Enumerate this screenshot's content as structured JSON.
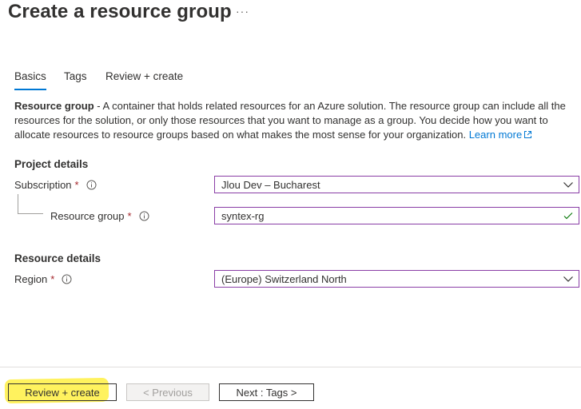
{
  "header": {
    "title": "Create a resource group",
    "more_label": "···"
  },
  "tabs": [
    {
      "label": "Basics",
      "active": true
    },
    {
      "label": "Tags",
      "active": false
    },
    {
      "label": "Review + create",
      "active": false
    }
  ],
  "description": {
    "bold": "Resource group",
    "text": " - A container that holds related resources for an Azure solution. The resource group can include all the resources for the solution, or only those resources that you want to manage as a group. You decide how you want to allocate resources to resource groups based on what makes the most sense for your organization. ",
    "link": "Learn more"
  },
  "project_details": {
    "heading": "Project details",
    "subscription": {
      "label": "Subscription",
      "required": "*",
      "value": "Jlou Dev – Bucharest"
    },
    "resource_group": {
      "label": "Resource group",
      "required": "*",
      "value": "syntex-rg"
    }
  },
  "resource_details": {
    "heading": "Resource details",
    "region": {
      "label": "Region",
      "required": "*",
      "value": "(Europe) Switzerland North"
    }
  },
  "footer": {
    "review_create": "Review + create",
    "previous": "< Previous",
    "next": "Next : Tags >"
  },
  "colors": {
    "accent": "#0078d4",
    "field_border": "#8a3ea6",
    "required": "#a4262c",
    "valid_check": "#107c10",
    "highlight": "#fff25e"
  },
  "icons": [
    "more-icon",
    "info-icon",
    "chevron-down-icon",
    "checkmark-icon",
    "external-link-icon"
  ]
}
